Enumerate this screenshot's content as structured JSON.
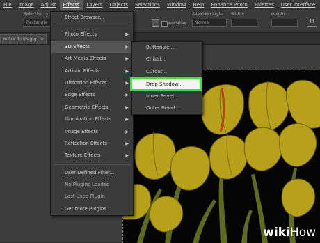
{
  "menubar": {
    "items": [
      "File",
      "Image",
      "Adjust",
      "Effects",
      "Layers",
      "Objects",
      "Selections",
      "Window",
      "Help",
      "Enhance Photo",
      "Palettes",
      "User Interface"
    ]
  },
  "options": {
    "selection_type_label": "Selection type:",
    "selection_type_value": "Rectangle",
    "selection_style_label": "Selection style:",
    "selection_style_value": "Normal",
    "width_label": "Width:",
    "height_label": "Height:",
    "antialias_label": "Antialias",
    "gear": "⚙"
  },
  "document_tab": {
    "title": "Yellow Tulips.jpg",
    "close": "×"
  },
  "effects_menu": {
    "items": [
      {
        "label": "Effect Browser...",
        "arrow": ""
      },
      {
        "label": "Photo Effects",
        "arrow": "▶"
      },
      {
        "label": "3D Effects",
        "arrow": "▶"
      },
      {
        "label": "Art Media Effects",
        "arrow": "▶"
      },
      {
        "label": "Artistic Effects",
        "arrow": "▶"
      },
      {
        "label": "Distortion Effects",
        "arrow": "▶"
      },
      {
        "label": "Edge Effects",
        "arrow": "▶"
      },
      {
        "label": "Geometric Effects",
        "arrow": "▶"
      },
      {
        "label": "Illumination Effects",
        "arrow": "▶"
      },
      {
        "label": "Image Effects",
        "arrow": "▶"
      },
      {
        "label": "Reflection Effects",
        "arrow": "▶"
      },
      {
        "label": "Texture Effects",
        "arrow": "▶"
      },
      {
        "label": "User Defined Filter...",
        "arrow": ""
      },
      {
        "label": "No Plugins Loaded",
        "arrow": ""
      },
      {
        "label": "Last Used Plugin",
        "arrow": ""
      },
      {
        "label": "Get more Plugins",
        "arrow": ""
      }
    ]
  },
  "submenu_3d": {
    "items": [
      "Buttonize...",
      "Chisel...",
      "Cutout...",
      "Drop Shadow...",
      "Inner Bevel...",
      "Outer Bevel..."
    ]
  },
  "watermark": {
    "wiki": "wiki",
    "how": "How"
  },
  "colors": {
    "highlight_border": "#3fe045",
    "tulip_yellow": "#b8a11a",
    "background": "#050505"
  }
}
